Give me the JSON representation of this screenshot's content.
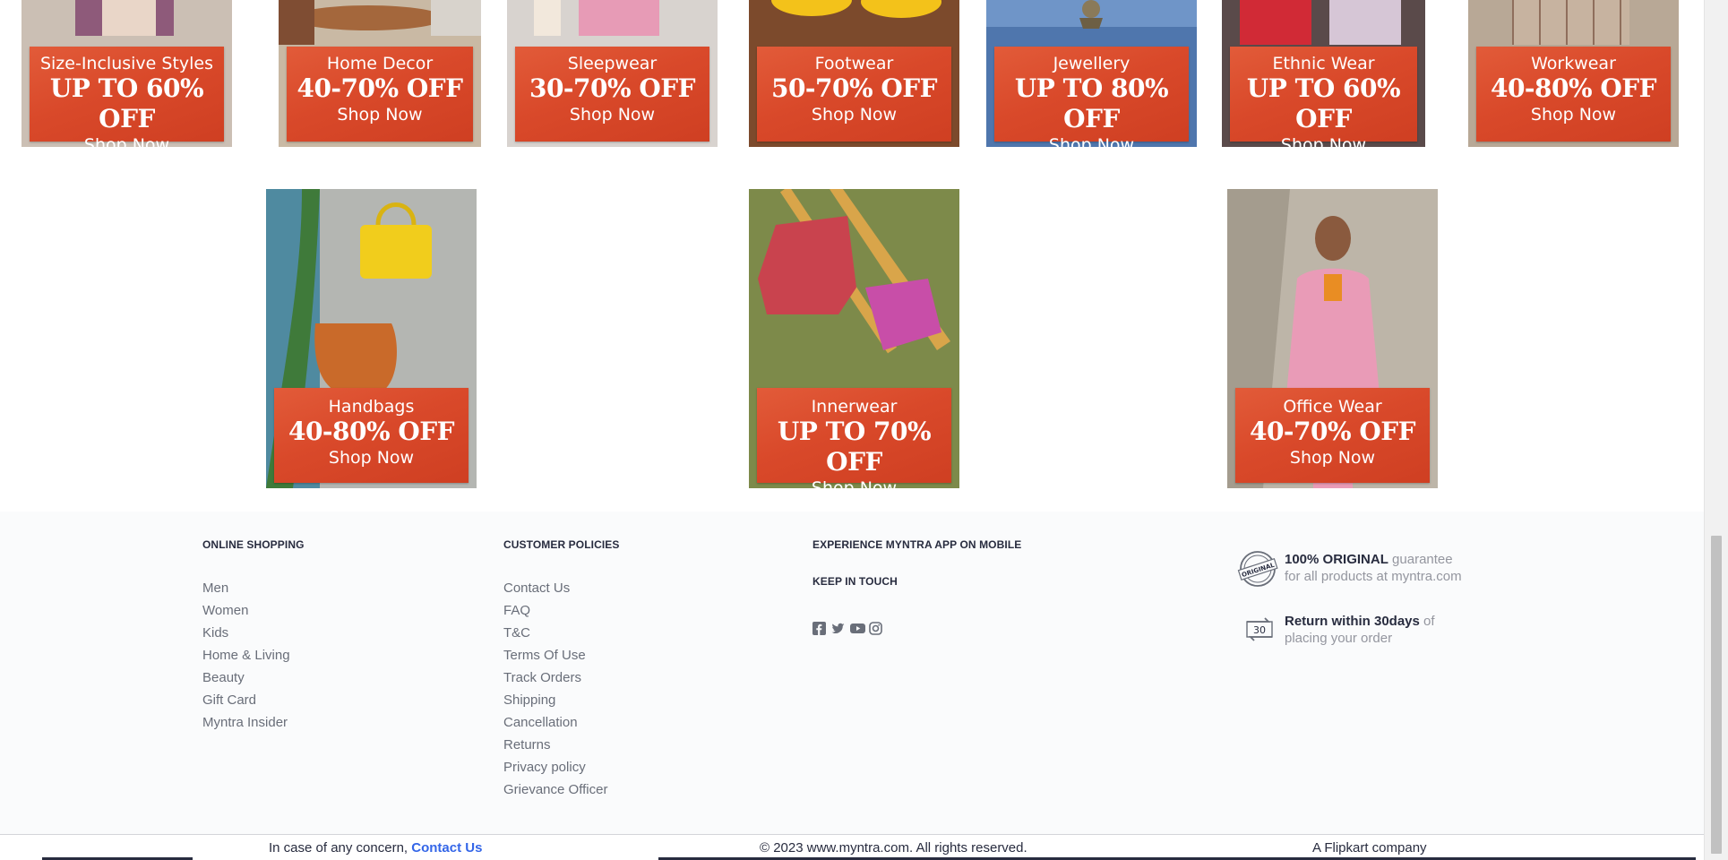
{
  "promos_row1": [
    {
      "category": "Size-Inclusive Styles",
      "deal": "UP TO 60% OFF",
      "cta": "Shop Now",
      "photo": "woman-in-printed-skirt"
    },
    {
      "category": "Home Decor",
      "deal": "40-70% OFF",
      "cta": "Shop Now",
      "photo": "living-room-coffee-table"
    },
    {
      "category": "Sleepwear",
      "deal": "30-70% OFF",
      "cta": "Shop Now",
      "photo": "pink-pajamas"
    },
    {
      "category": "Footwear",
      "deal": "50-70% OFF",
      "cta": "Shop Now",
      "photo": "yellow-sneakers"
    },
    {
      "category": "Jewellery",
      "deal": "UP TO 80% OFF",
      "cta": "Shop Now",
      "photo": "jhumka-earring"
    },
    {
      "category": "Ethnic Wear",
      "deal": "UP TO 60% OFF",
      "cta": "Shop Now",
      "photo": "red-saree"
    },
    {
      "category": "Workwear",
      "deal": "40-80% OFF",
      "cta": "Shop Now",
      "photo": "checked-blazer"
    }
  ],
  "promos_row2": [
    {
      "category": "Handbags",
      "deal": "40-80% OFF",
      "cta": "Shop Now",
      "photo": "yellow-and-tan-handbags"
    },
    {
      "category": "Innerwear",
      "deal": "UP TO 70% OFF",
      "cta": "Shop Now",
      "photo": "tank-top-and-shorts-on-ladder"
    },
    {
      "category": "Office Wear",
      "deal": "40-70% OFF",
      "cta": "Shop Now",
      "photo": "woman-in-pink-blazer"
    }
  ],
  "footer": {
    "online_shopping": {
      "heading": "ONLINE SHOPPING",
      "links": [
        "Men",
        "Women",
        "Kids",
        "Home & Living",
        "Beauty",
        "Gift Card",
        "Myntra Insider"
      ]
    },
    "customer_policies": {
      "heading": "CUSTOMER POLICIES",
      "links": [
        "Contact Us",
        "FAQ",
        "T&C",
        "Terms Of Use",
        "Track Orders",
        "Shipping",
        "Cancellation",
        "Returns",
        "Privacy policy",
        "Grievance Officer"
      ]
    },
    "app": {
      "heading": "EXPERIENCE MYNTRA APP ON MOBILE",
      "keep_in_touch": "KEEP IN TOUCH",
      "social_icons": [
        "facebook-icon",
        "twitter-icon",
        "youtube-icon",
        "instagram-icon"
      ]
    },
    "promises": [
      {
        "icon": "original-seal-icon",
        "bold": "100% ORIGINAL",
        "rest": "guarantee",
        "line2": "for all products at myntra.com"
      },
      {
        "icon": "return-30-icon",
        "bold": "Return within 30days",
        "rest": "of",
        "line2": "placing your order"
      }
    ]
  },
  "bottom": {
    "concern_text": "In case of any concern,",
    "contact_link": "Contact Us",
    "copyright": "© 2023 www.myntra.com. All rights reserved.",
    "company": "A Flipkart company"
  },
  "colors": {
    "promo_panel": "#d9492a",
    "link_blue": "#3466e8",
    "footer_bg": "#fafbfc",
    "text_dark": "#282c3f",
    "text_grey": "#696e79"
  }
}
